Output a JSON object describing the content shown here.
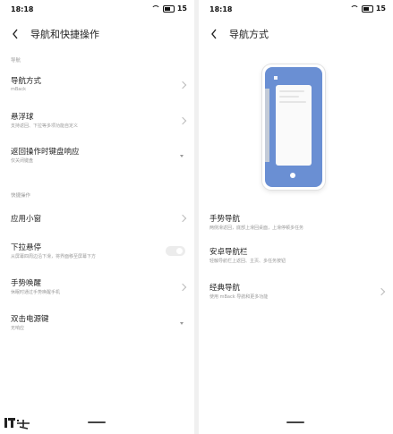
{
  "left": {
    "status": {
      "time": "18:18",
      "battery": "15"
    },
    "header": {
      "title": "导航和快捷操作"
    },
    "section_nav": "导航",
    "items_nav": [
      {
        "label": "导航方式",
        "sub": "mBack"
      },
      {
        "label": "悬浮球",
        "sub": "支持返回、下拉等多项功能自定义"
      },
      {
        "label": "返回操作时键盘响应",
        "sub": "仅关闭键盘"
      }
    ],
    "section_shortcut": "快捷操作",
    "items_shortcut": [
      {
        "label": "应用小窗",
        "sub": ""
      },
      {
        "label": "下拉悬停",
        "sub": "从屏幕四周边沿下滑，将界面移至屏幕下方"
      },
      {
        "label": "手势唤醒",
        "sub": "休眠时通过手势唤醒手机"
      },
      {
        "label": "双击电源键",
        "sub": "无响应"
      }
    ]
  },
  "right": {
    "status": {
      "time": "18:18",
      "battery": "15"
    },
    "header": {
      "title": "导航方式"
    },
    "options": [
      {
        "label": "手势导航",
        "sub": "两侧滑返回，底部上滑回桌面，上滑停顿多任务"
      },
      {
        "label": "安卓导航栏",
        "sub": "轻触导航栏上返回、主页、多任务按钮"
      },
      {
        "label": "经典导航",
        "sub": "使用 mBack 导航和更多功能"
      }
    ]
  },
  "watermark": "IT之家",
  "colors": {
    "accent": "#6a8fd3",
    "divider": "#f0f0f0",
    "text_primary": "#222222",
    "text_secondary": "#999999"
  }
}
